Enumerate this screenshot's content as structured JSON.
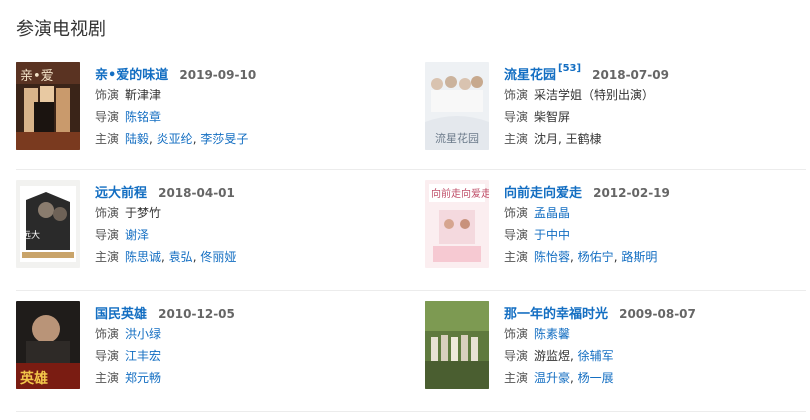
{
  "section_title": "参演电视剧",
  "labels": {
    "role": "饰演",
    "director": "导演",
    "cast": "主演"
  },
  "dramas": [
    {
      "title": "亲•爱的味道",
      "ref": "",
      "date": "2019-09-10",
      "role": "靳津津",
      "role_link": false,
      "director": "陈铭章",
      "director_link": true,
      "cast": [
        "陆毅",
        "炎亚纶",
        "李莎旻子"
      ],
      "cast_link": true,
      "poster_icon": "poster-qin-ai-de-wei-dao"
    },
    {
      "title": "流星花园",
      "ref": "[53]",
      "date": "2018-07-09",
      "role": "采洁学姐（特别出演）",
      "role_link": false,
      "director": "柴智屏",
      "director_link": false,
      "cast": [
        "沈月",
        "王鹤棣"
      ],
      "cast_link": false,
      "poster_icon": "poster-liu-xing-hua-yuan"
    },
    {
      "title": "远大前程",
      "ref": "",
      "date": "2018-04-01",
      "role": "于梦竹",
      "role_link": false,
      "director": "谢泽",
      "director_link": true,
      "cast": [
        "陈思诚",
        "袁弘",
        "佟丽娅"
      ],
      "cast_link": true,
      "poster_icon": "poster-yuan-da-qian-cheng"
    },
    {
      "title": "向前走向爱走",
      "ref": "",
      "date": "2012-02-19",
      "role": "孟晶晶",
      "role_link": true,
      "director": "于中中",
      "director_link": true,
      "cast": [
        "陈怡蓉",
        "杨佑宁",
        "路斯明"
      ],
      "cast_link": true,
      "poster_icon": "poster-xiang-qian-zou"
    },
    {
      "title": "国民英雄",
      "ref": "",
      "date": "2010-12-05",
      "role": "洪小绿",
      "role_link": true,
      "director": "江丰宏",
      "director_link": true,
      "cast": [
        "郑元畅"
      ],
      "cast_link": true,
      "poster_icon": "poster-guo-min-ying-xiong"
    },
    {
      "title": "那一年的幸福时光",
      "ref": "",
      "date": "2009-08-07",
      "role": "陈素馨",
      "role_link": true,
      "director": "游监煜",
      "director_link": false,
      "director_extra": "徐辅军",
      "cast": [
        "温升豪",
        "杨一展"
      ],
      "cast_link": true,
      "poster_icon": "poster-na-yi-nian"
    }
  ],
  "colors": {
    "link": "#136ec2",
    "text": "#333333",
    "muted": "#666666",
    "divider": "#ececec"
  }
}
